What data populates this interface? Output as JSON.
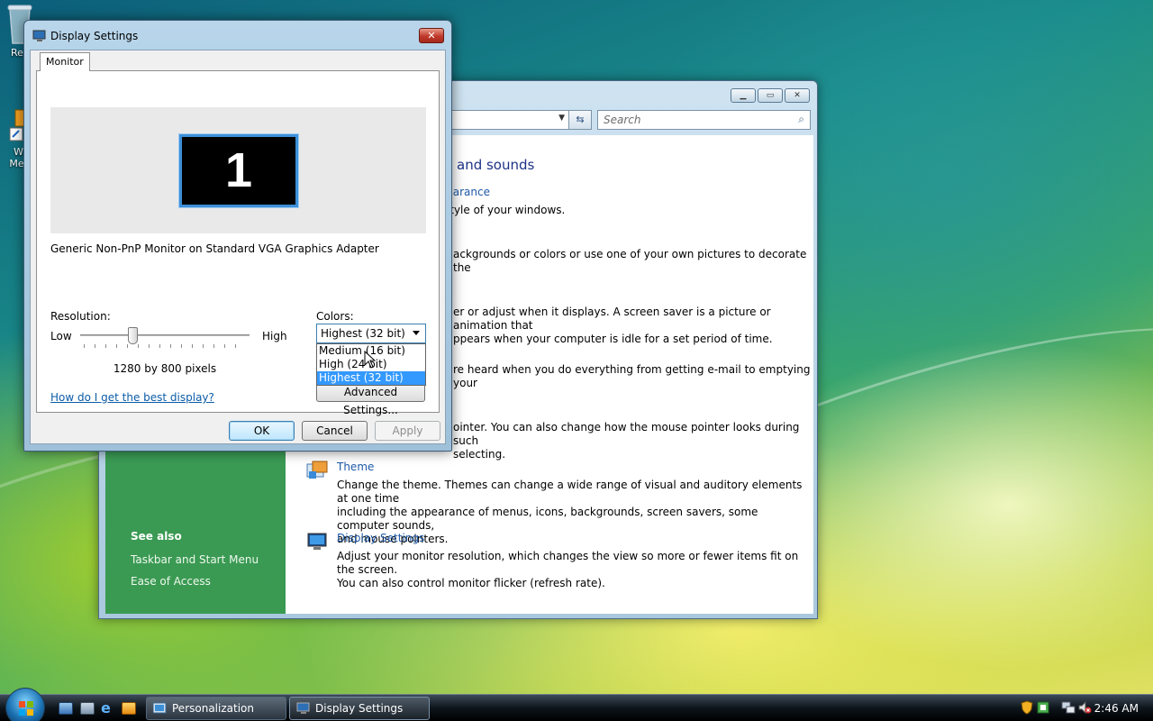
{
  "desktop": {
    "icons": [
      {
        "label": "Rec"
      },
      {
        "label": "Wi Med"
      }
    ]
  },
  "personalization": {
    "search_placeholder": "Search",
    "heading": "and sounds",
    "tasks": [
      {
        "link": "arance",
        "desc": "style of your windows."
      },
      {
        "link": "",
        "desc": "ackgrounds or colors or use one of your own pictures to decorate the"
      },
      {
        "link": "",
        "desc": "er or adjust when it displays. A screen saver is a picture or animation that\nppears when your computer is idle for a set period of time."
      },
      {
        "link": "",
        "desc": "re heard when you do everything from getting e-mail to emptying your"
      },
      {
        "link": "",
        "desc": "ointer. You can also change how the mouse pointer looks during such\nselecting."
      },
      {
        "link": "Theme",
        "desc": "Change the theme. Themes can change a wide range of visual and auditory elements at one time\nincluding the appearance of menus, icons, backgrounds, screen savers, some computer sounds,\nand mouse pointers."
      },
      {
        "link": "Display Settings",
        "desc": "Adjust your monitor resolution, which changes the view so more or fewer items fit on the screen.\nYou can also control monitor flicker (refresh rate)."
      }
    ],
    "see_also": {
      "header": "See also",
      "links": [
        "Taskbar and Start Menu",
        "Ease of Access"
      ]
    }
  },
  "dialog": {
    "title": "Display Settings",
    "close_label": "✕",
    "tab": "Monitor",
    "monitor_number": "1",
    "adapter": "Generic Non-PnP Monitor on Standard VGA Graphics Adapter",
    "resolution_label": "Resolution:",
    "low_label": "Low",
    "high_label": "High",
    "resolution_value": "1280 by 800 pixels",
    "slider_fraction": 0.31,
    "colors_label": "Colors:",
    "colors_selected": "Highest (32 bit)",
    "color_options": [
      "Medium (16 bit)",
      "High (24 bit)",
      "Highest (32 bit)"
    ],
    "advanced_label": "Advanced Settings...",
    "help_link": "How do I get the best display?",
    "ok_label": "OK",
    "cancel_label": "Cancel",
    "apply_label": "Apply"
  },
  "taskbar": {
    "buttons": [
      {
        "label": "Personalization"
      },
      {
        "label": "Display Settings"
      }
    ],
    "clock": "2:46 AM"
  }
}
